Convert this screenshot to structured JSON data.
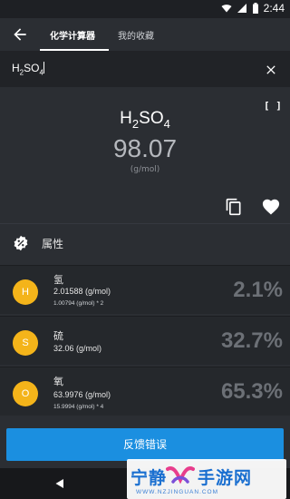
{
  "status_bar": {
    "time": "2:44",
    "icons": [
      "wifi-icon",
      "signal-icon",
      "battery-icon"
    ]
  },
  "app_bar": {
    "back_icon": "arrow-left-icon",
    "tabs": [
      {
        "label": "化学计算器",
        "active": true
      },
      {
        "label": "我的收藏",
        "active": false
      }
    ]
  },
  "search": {
    "formula_base": "H",
    "formula_sub1": "2",
    "formula_mid": "SO",
    "formula_sub2": "4",
    "clear_icon": "close-icon"
  },
  "result": {
    "bracket_label": "[ ]",
    "formula_base": "H",
    "formula_sub1": "2",
    "formula_mid": "SO",
    "formula_sub2": "4",
    "molar_mass": "98.07",
    "unit": "(g/mol)",
    "copy_icon": "copy-icon",
    "favorite_icon": "heart-icon"
  },
  "properties": {
    "title": "属性",
    "icon": "badge-percent-icon"
  },
  "elements": [
    {
      "symbol": "H",
      "name": "氢",
      "mass": "2.01588 (g/mol)",
      "detail": "1.00794 (g/mol) * 2",
      "percent": "2.1%"
    },
    {
      "symbol": "S",
      "name": "硫",
      "mass": "32.06 (g/mol)",
      "detail": "",
      "percent": "32.7%"
    },
    {
      "symbol": "O",
      "name": "氧",
      "mass": "63.9976 (g/mol)",
      "detail": "15.9994 (g/mol) * 4",
      "percent": "65.3%"
    }
  ],
  "report_button": {
    "label": "反馈错误"
  },
  "colors": {
    "accent": "#1b8fe0",
    "element_circle": "#f4b41a",
    "background": "#2b2e33"
  },
  "watermark": {
    "left": "宁静",
    "right": "手游网",
    "url": "WWW.NZJINGUAN.COM"
  }
}
